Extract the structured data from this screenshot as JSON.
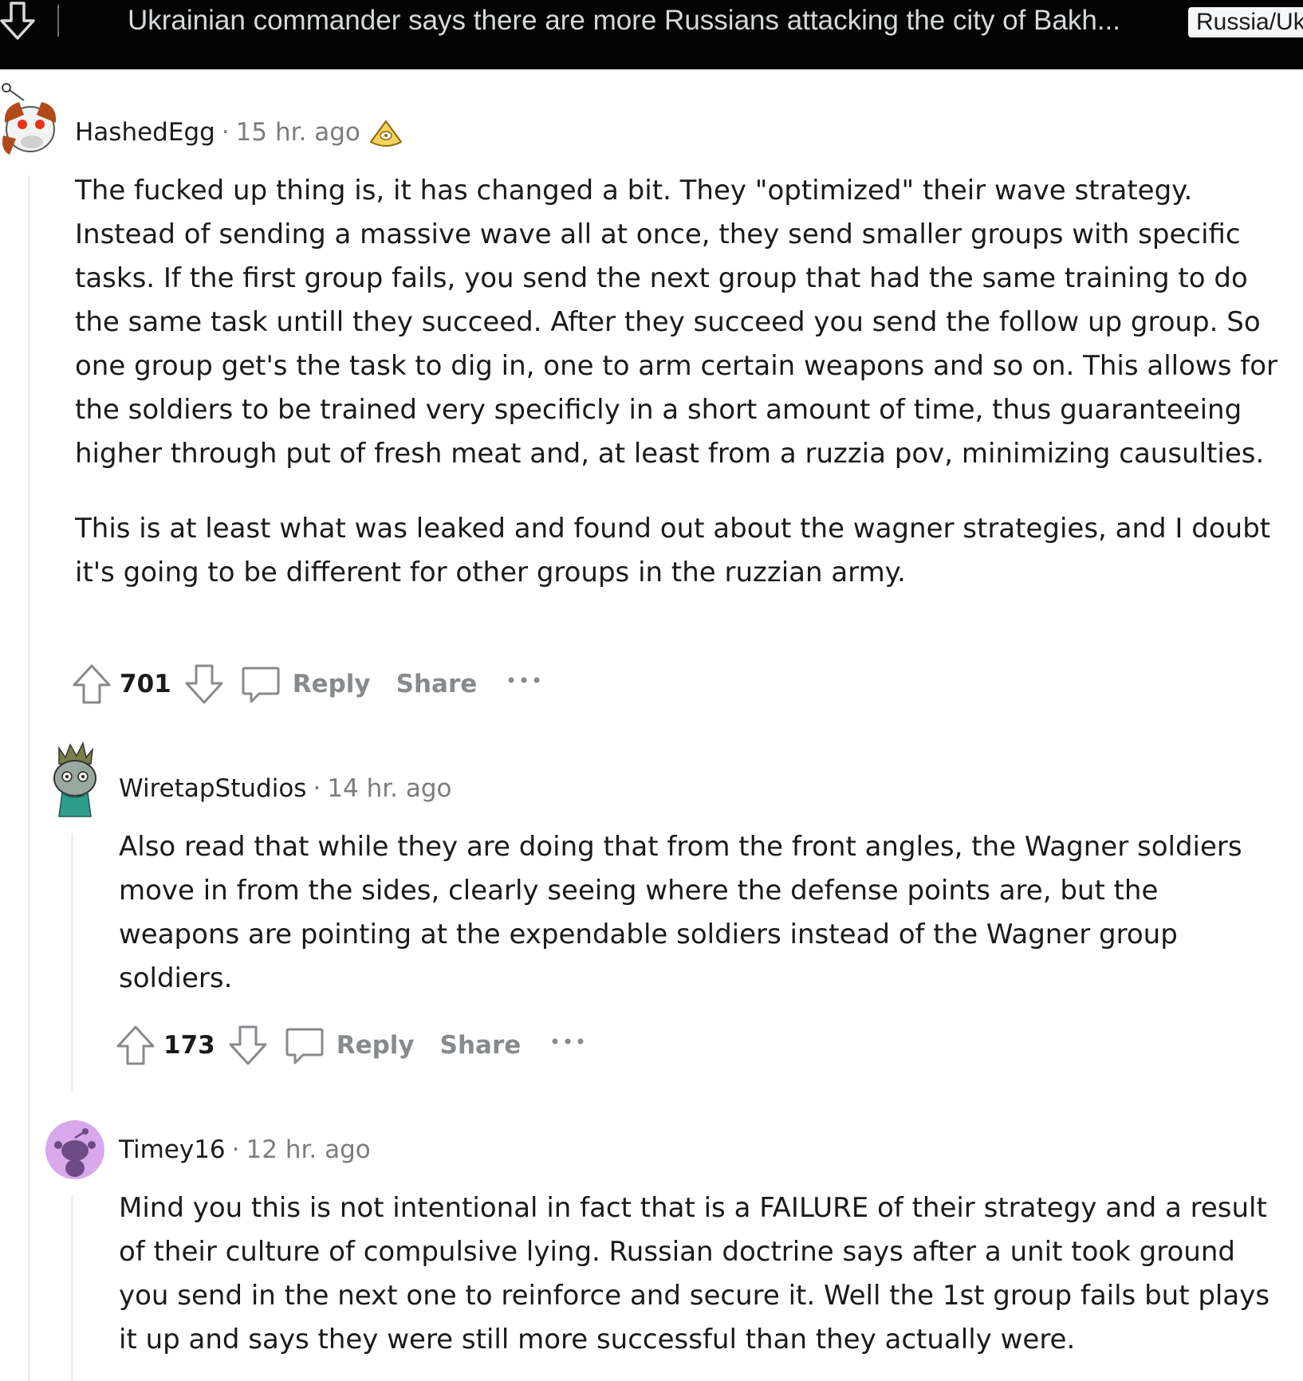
{
  "topbar": {
    "title": "Ukrainian commander says there are more Russians attacking the city of Bakh...",
    "flair": "Russia/Ukraine"
  },
  "comments": [
    {
      "author": "HashedEgg",
      "separator": "·",
      "time": "15 hr. ago",
      "paragraphs": [
        "The fucked up thing is, it has changed a bit. They \"optimized\" their wave strategy. Instead of sending a massive wave all at once, they send smaller groups with specific tasks. If the first group fails, you send the next group that had the same training to do the same task untill they succeed. After they succeed you send the follow up group. So one group get's the task to dig in, one to arm certain weapons and so on. This allows for the soldiers to be trained very specificly in a short amount of time, thus guaranteeing higher through put of fresh meat and, at least from a ruzzia pov, minimizing causulties.",
        "This is at least what was leaked and found out about the wagner strategies, and I doubt it's going to be different for other groups in the ruzzian army."
      ],
      "score": "701",
      "reply_label": "Reply",
      "share_label": "Share"
    },
    {
      "author": "WiretapStudios",
      "separator": "·",
      "time": "14 hr. ago",
      "paragraphs": [
        "Also read that while they are doing that from the front angles, the Wagner soldiers move in from the sides, clearly seeing where the defense points are, but the weapons are pointing at the expendable soldiers instead of the Wagner group soldiers."
      ],
      "score": "173",
      "reply_label": "Reply",
      "share_label": "Share"
    },
    {
      "author": "Timey16",
      "separator": "·",
      "time": "12 hr. ago",
      "paragraphs": [
        "Mind you this is not intentional in fact that is a FAILURE of their strategy and a result of their culture of compulsive lying. Russian doctrine says after a unit took ground you send in the next one to reinforce and secure it. Well the 1st group fails but plays it up and says they were still more successful than they actually were."
      ]
    }
  ],
  "colors": {
    "topbar_bg": "#030303",
    "topbar_text": "#d7dadc",
    "meta_grey": "#7c7c7c",
    "action_grey": "#878a8c",
    "thread_line": "#edeff1",
    "timey_avatar_bg": "#d9a8ec"
  },
  "icons": {
    "topbar_down": "arrow-down-icon",
    "upvote": "arrow-up-icon",
    "downvote": "arrow-down-icon",
    "reply": "speech-bubble-icon",
    "more": "ellipsis-icon",
    "award": "award-icon"
  }
}
